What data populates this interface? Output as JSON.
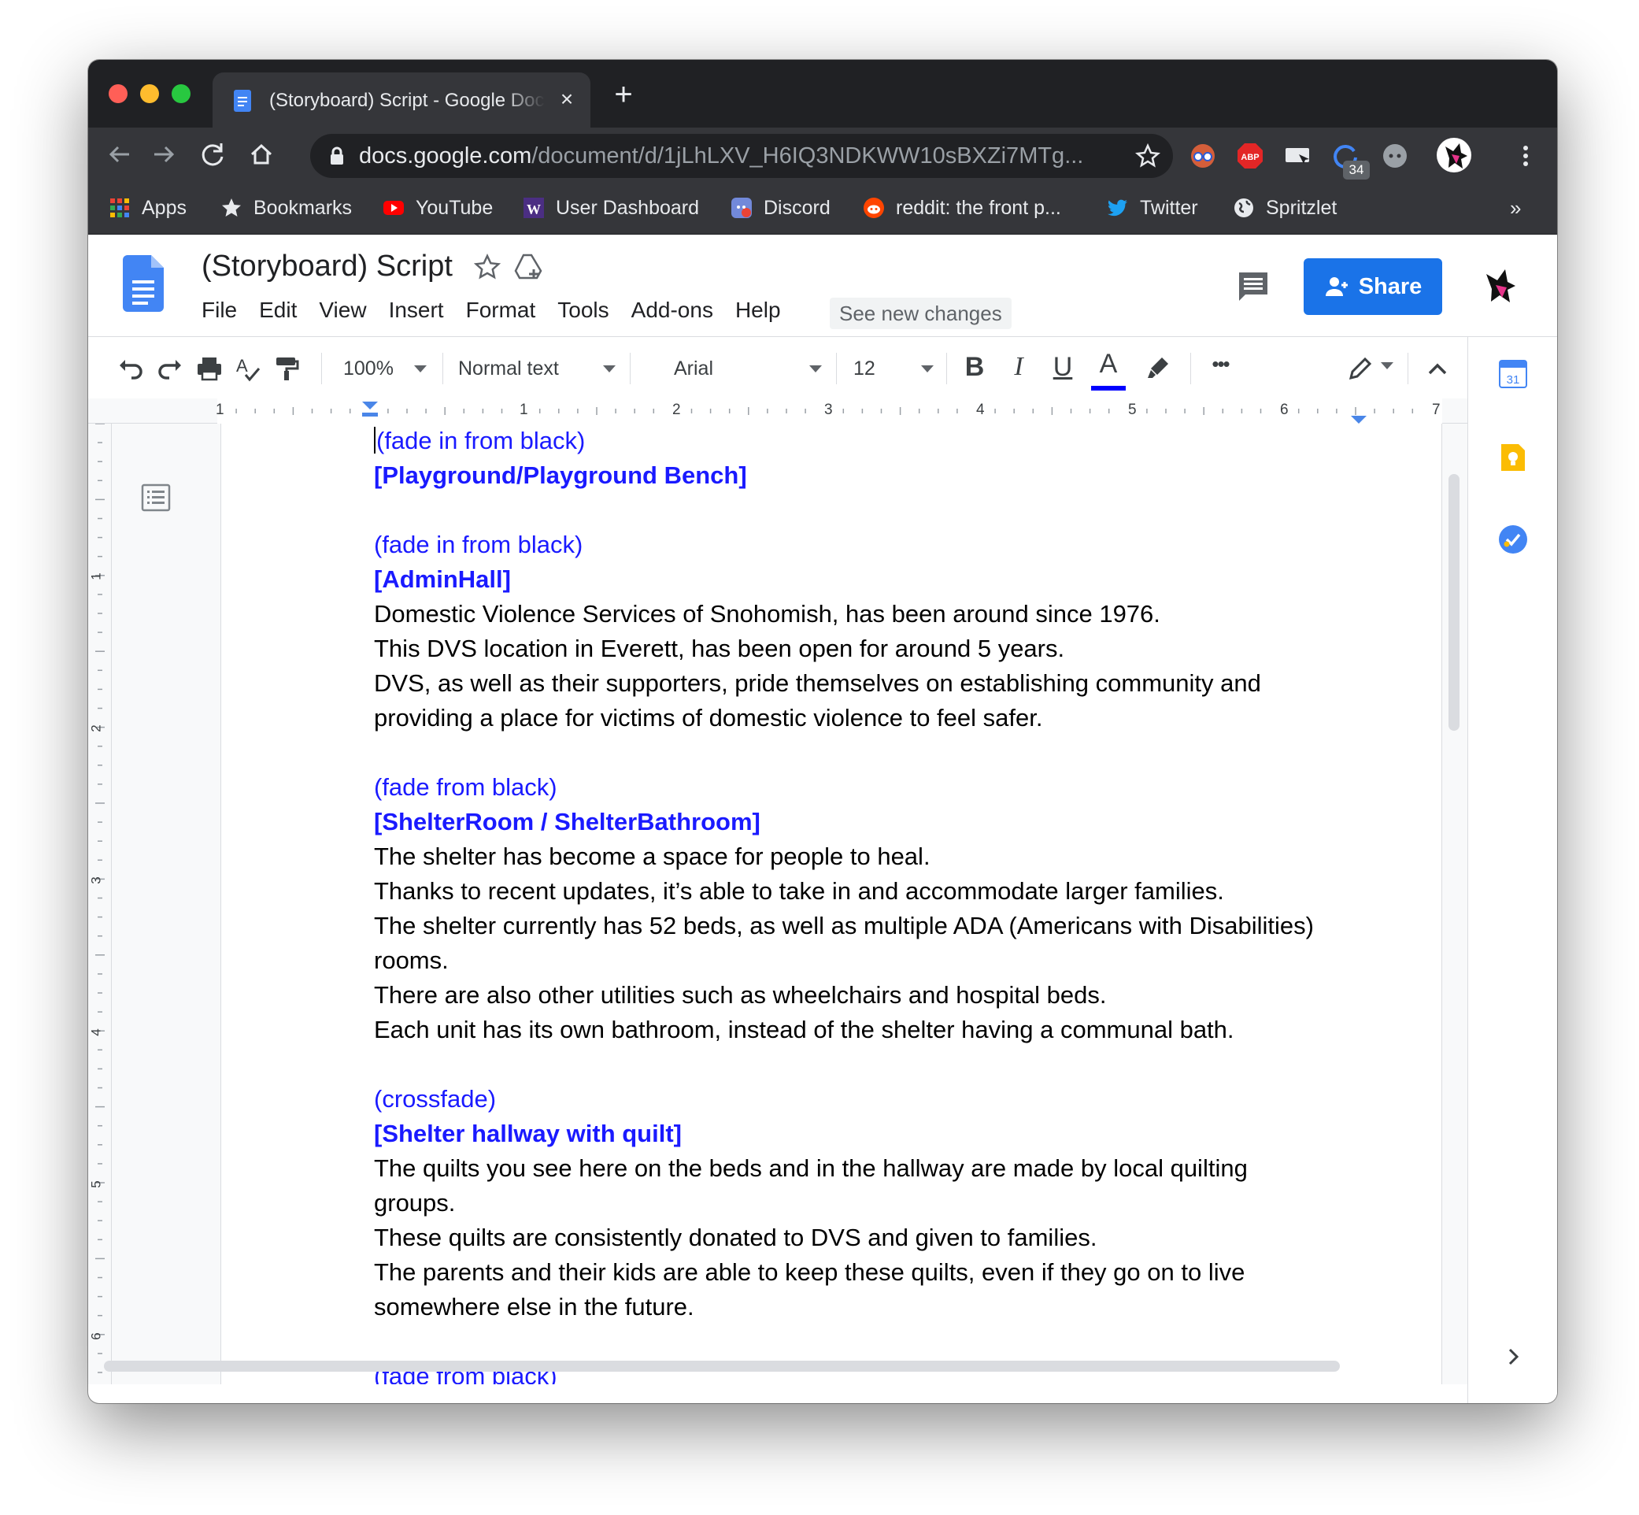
{
  "browser": {
    "tab_title": "(Storyboard) Script - Google Docs",
    "url_host": "docs.google.com",
    "url_path": "/document/d/1jLhLXV_H6IQ3NDKWW10sBXZi7MTg...",
    "extension_badge": "34",
    "bookmarks": [
      "Apps",
      "Bookmarks",
      "YouTube",
      "User Dashboard",
      "Discord",
      "reddit: the front p...",
      "Twitter",
      "Spritzlet"
    ],
    "bookmarks_overflow": "»"
  },
  "doc": {
    "title": "(Storyboard) Script",
    "menu": [
      "File",
      "Edit",
      "Insert",
      "View",
      "Format",
      "Tools",
      "Add-ons",
      "Help"
    ],
    "see_new_changes": "See new changes",
    "share_label": "Share"
  },
  "toolbar": {
    "zoom": "100%",
    "style": "Normal text",
    "font": "Arial",
    "font_size": "12",
    "bold": "B",
    "italic": "I",
    "underline": "U",
    "text_color": "A",
    "more": "•••",
    "text_color_value": "#0000ff"
  },
  "ruler": {
    "horizontal": [
      "1",
      "1",
      "2",
      "3",
      "4",
      "5",
      "6",
      "7"
    ],
    "vertical": [
      "1",
      "2",
      "3",
      "4",
      "5",
      "6"
    ]
  },
  "side_panel": {
    "calendar_day": "31"
  },
  "content": {
    "paragraphs": [
      "(fade in from black)",
      "[Playground/Playground Bench]",
      "",
      "(fade in from black)",
      "[AdminHall]",
      "Domestic Violence Services of Snohomish, has been around since 1976.",
      "This DVS location in Everett, has been open for around 5 years.",
      "DVS, as well as their supporters, pride themselves on establishing community and",
      "providing a place for victims of domestic violence to feel safer.",
      "",
      "(fade from black)",
      "[ShelterRoom / ShelterBathroom]",
      "The shelter has become a space for people to heal.",
      "Thanks to recent updates, it’s able to take in and accommodate larger families.",
      "The shelter currently has 52 beds, as well as multiple ADA (Americans with Disabilities)",
      "rooms.",
      "There are also other utilities such as wheelchairs and hospital beds.",
      "Each unit has its own bathroom, instead of the shelter having a communal bath.",
      "",
      "(crossfade)",
      "[Shelter hallway with quilt]",
      "The quilts you see here on the beds and in the hallway are made by local quilting",
      "groups.",
      "These quilts are consistently donated to DVS and given to families.",
      "The parents and their kids are able to keep these quilts, even if they go on to live",
      "somewhere else in the future.",
      "",
      "(fade from black)"
    ]
  }
}
